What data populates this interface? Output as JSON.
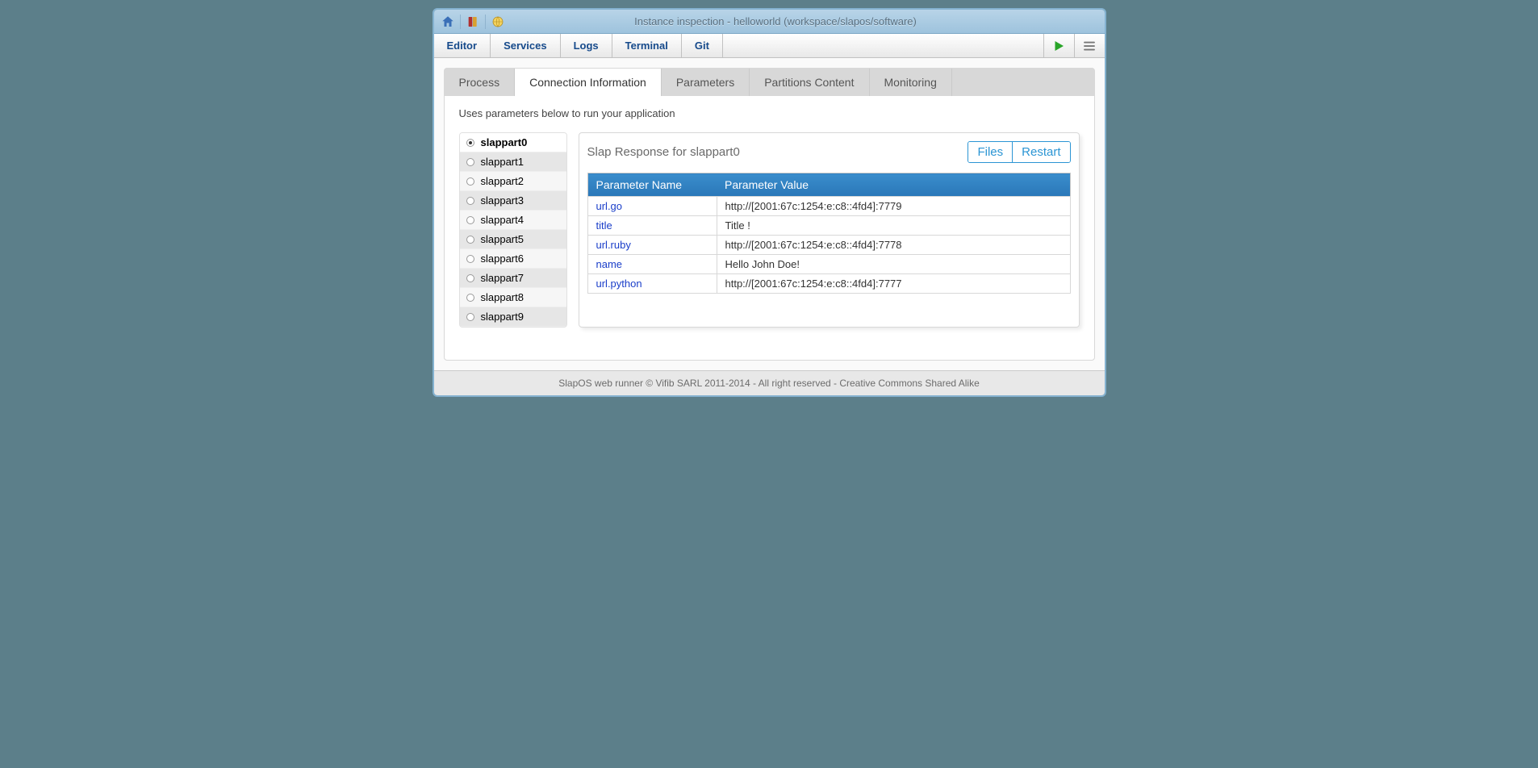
{
  "titlebar": {
    "title": "Instance inspection - helloworld (workspace/slapos/software)"
  },
  "menu": {
    "items": [
      "Editor",
      "Services",
      "Logs",
      "Terminal",
      "Git"
    ]
  },
  "tabs": {
    "items": [
      "Process",
      "Connection Information",
      "Parameters",
      "Partitions Content",
      "Monitoring"
    ],
    "active_index": 1
  },
  "hint": "Uses parameters below to run your application",
  "partitions": {
    "items": [
      "slappart0",
      "slappart1",
      "slappart2",
      "slappart3",
      "slappart4",
      "slappart5",
      "slappart6",
      "slappart7",
      "slappart8",
      "slappart9"
    ],
    "selected_index": 0
  },
  "detail": {
    "title": "Slap Response for slappart0",
    "buttons": {
      "files": "Files",
      "restart": "Restart"
    },
    "table": {
      "headers": [
        "Parameter Name",
        "Parameter Value"
      ],
      "rows": [
        {
          "name": "url.go",
          "value": "http://[2001:67c:1254:e:c8::4fd4]:7779"
        },
        {
          "name": "title",
          "value": "Title !"
        },
        {
          "name": "url.ruby",
          "value": "http://[2001:67c:1254:e:c8::4fd4]:7778"
        },
        {
          "name": "name",
          "value": "Hello John Doe!"
        },
        {
          "name": "url.python",
          "value": "http://[2001:67c:1254:e:c8::4fd4]:7777"
        }
      ]
    }
  },
  "footer": "SlapOS web runner © Vifib SARL 2011-2014 - All right reserved - Creative Commons Shared Alike"
}
